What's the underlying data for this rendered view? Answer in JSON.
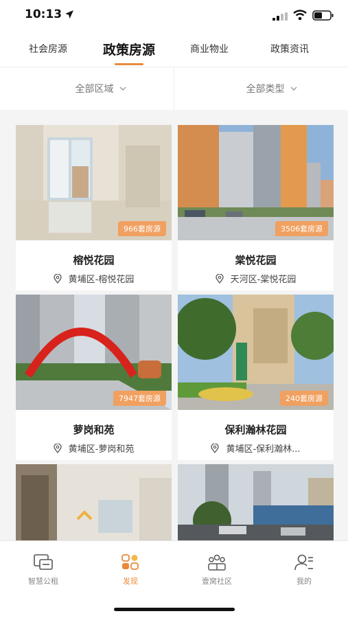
{
  "status_bar": {
    "time": "10:13"
  },
  "top_tabs": [
    {
      "label": "社会房源",
      "active": false
    },
    {
      "label": "政策房源",
      "active": true
    },
    {
      "label": "商业物业",
      "active": false
    },
    {
      "label": "政策资讯",
      "active": false
    }
  ],
  "filters": {
    "area": "全部区域",
    "type": "全部类型"
  },
  "listings": [
    {
      "name": "榕悦花园",
      "location": "黄埔区-榕悦花园",
      "badge": "966套房源"
    },
    {
      "name": "棠悦花园",
      "location": "天河区-棠悦花园",
      "badge": "3506套房源"
    },
    {
      "name": "萝岗和苑",
      "location": "黄埔区-萝岗和苑",
      "badge": "7947套房源"
    },
    {
      "name": "保利瀚林花园",
      "location": "黄埔区-保利瀚林...",
      "badge": "240套房源"
    }
  ],
  "bottom_nav": [
    {
      "label": "智慧公租",
      "icon": "card-icon",
      "active": false
    },
    {
      "label": "发现",
      "icon": "discover-grid-icon",
      "active": true
    },
    {
      "label": "壹窝社区",
      "icon": "community-icon",
      "active": false
    },
    {
      "label": "我的",
      "icon": "profile-icon",
      "active": false
    }
  ],
  "colors": {
    "accent": "#e88a3a",
    "badge": "#f0a060"
  }
}
